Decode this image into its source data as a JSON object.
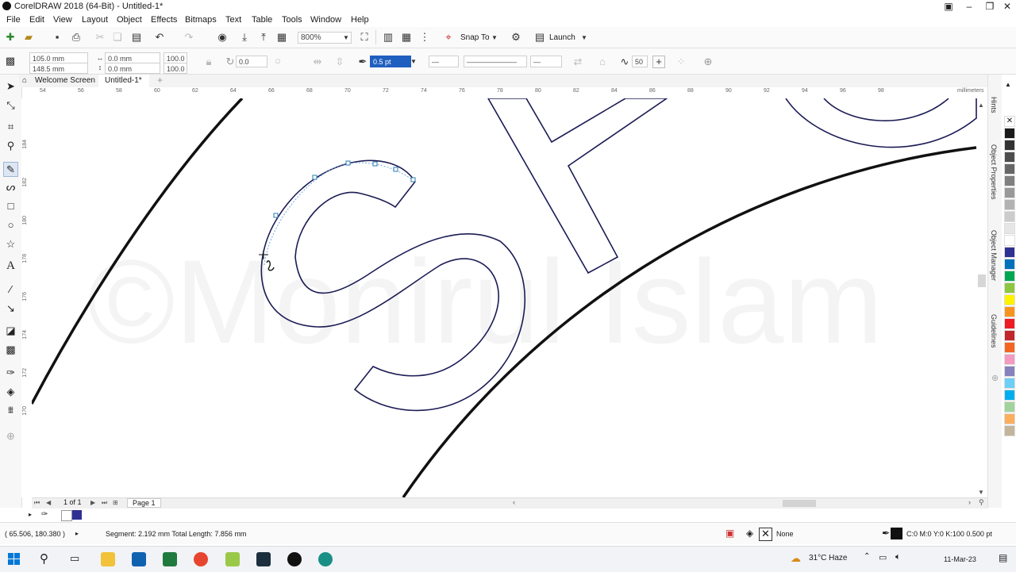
{
  "window": {
    "title": "CorelDRAW 2018 (64-Bit) - Untitled-1*"
  },
  "menu": [
    "File",
    "Edit",
    "View",
    "Layout",
    "Object",
    "Effects",
    "Bitmaps",
    "Text",
    "Table",
    "Tools",
    "Window",
    "Help"
  ],
  "stdbar": {
    "zoom": "800%",
    "snap_label": "Snap To",
    "launch_label": "Launch"
  },
  "propbar": {
    "x": "105.0 mm",
    "y": "148.5 mm",
    "w": "0.0 mm",
    "h": "0.0 mm",
    "sx": "100.0",
    "sy": "100.0",
    "angle": "0.0",
    "outline_width": "0.5 pt",
    "smoothing": "50"
  },
  "tabs": {
    "welcome": "Welcome Screen",
    "doc": "Untitled-1*"
  },
  "ruler": {
    "h_labels": [
      "54",
      "56",
      "58",
      "60",
      "62",
      "64",
      "66",
      "68",
      "70",
      "72",
      "74",
      "76",
      "78",
      "80",
      "82",
      "84",
      "86",
      "88",
      "90",
      "92",
      "94",
      "96",
      "98"
    ],
    "h_unit": "millimeters",
    "v_labels": [
      "184",
      "182",
      "180",
      "178",
      "176",
      "174",
      "172",
      "170"
    ]
  },
  "docker": {
    "tabs": [
      "Hints",
      "Object Properties",
      "Object Manager",
      "Guidelines"
    ]
  },
  "watermark": "©Monirul Islam",
  "pagenav": {
    "page_count": "1 of 1",
    "page_tab": "Page 1"
  },
  "status": {
    "coords": "( 65.506, 180.380 )",
    "segment": "Segment: 2.192 mm Total Length: 7.856 mm",
    "fill": "None",
    "outline": "C:0 M:0 Y:0 K:100  0.500 pt"
  },
  "taskbar": {
    "weather": "31°C  Haze",
    "date": "11-Mar-23"
  },
  "palette": [
    "#ffffff",
    "#1a1a1a",
    "#333333",
    "#4d4d4d",
    "#666666",
    "#808080",
    "#999999",
    "#b3b3b3",
    "#cccccc",
    "#e6e6e6",
    "#ffffff",
    "#2e3192",
    "#0072bc",
    "#00a651",
    "#8dc63f",
    "#fff200",
    "#f7941d",
    "#ed1c24",
    "#c1272d",
    "#f26522",
    "#f49ac1",
    "#8781bd",
    "#6dcff6",
    "#00aeef",
    "#a3d39c",
    "#fbaf5d",
    "#c2b59b"
  ]
}
